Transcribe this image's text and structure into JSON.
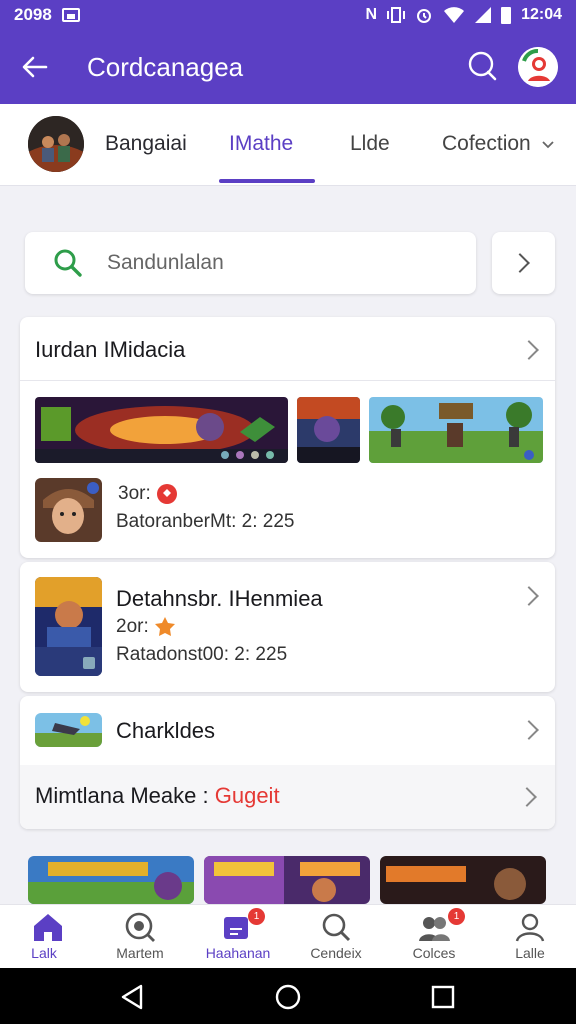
{
  "status_bar": {
    "time_left": "2098",
    "time_right": "12:04",
    "notification_letter": "N"
  },
  "app_bar": {
    "title": "Cordcanagea"
  },
  "tabs": [
    {
      "label": "Bangaiai"
    },
    {
      "label": "IMathe"
    },
    {
      "label": "Llde"
    },
    {
      "label": "Cofection"
    }
  ],
  "search": {
    "placeholder": "Sandunlalan"
  },
  "section": {
    "title": "Iurdan IMidacia"
  },
  "game_1": {
    "line1": "3or:",
    "line2": "BatoranberMt: 2: 225"
  },
  "game_2": {
    "title": "Detahnsbr. IHenmiea",
    "line1": "2or:",
    "line2": "Ratadonst00: 2: 225"
  },
  "card_3": {
    "item_title": "Charkldes",
    "row_label": "Mimtlana Meake : ",
    "row_highlight": "Gugeit",
    "highlight_color": "#e53935"
  },
  "bottom_nav": [
    {
      "label": "Lalk",
      "icon": "home-icon",
      "badge": ""
    },
    {
      "label": "Martem",
      "icon": "explore-icon",
      "badge": ""
    },
    {
      "label": "Haahanan",
      "icon": "edit-icon",
      "badge": "1"
    },
    {
      "label": "Cendeix",
      "icon": "search-icon",
      "badge": ""
    },
    {
      "label": "Colces",
      "icon": "people-icon",
      "badge": "1"
    },
    {
      "label": "Lalle",
      "icon": "profile-icon",
      "badge": ""
    }
  ],
  "colors": {
    "accent": "#5b3fc4",
    "search_green": "#2e9d4a"
  }
}
